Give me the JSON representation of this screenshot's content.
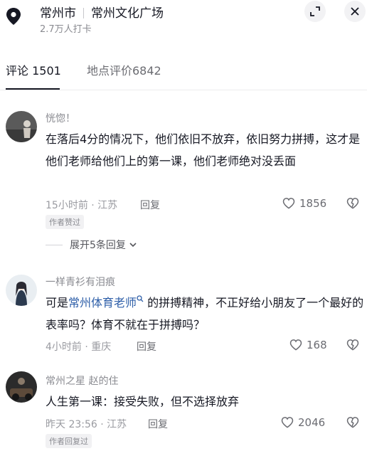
{
  "header": {
    "city": "常州市",
    "place": "常州文化广场",
    "checkins": "2.7万人打卡"
  },
  "tabs": [
    {
      "label": "评论 1501",
      "active": true
    },
    {
      "label": "地点评价6842",
      "active": false
    }
  ],
  "comments": [
    {
      "author": "恍惚！",
      "text": "在落后4分的情况下，他们依旧不放弃，依旧努力拼搏，这才是他们老师给他们上的第一课，他们老师绝对没丢面",
      "time": "15小时前 · 江苏",
      "reply": "回复",
      "likes": "1856",
      "badge": "作者赞过",
      "more": "展开5条回复"
    },
    {
      "author": "一样青衫有泪痕",
      "text_before": "可是",
      "link": "常州体育老师",
      "text_after": " 的拼搏精神，不正好给小朋友了一个最好的表率吗？体育不就在于拼搏吗？",
      "time": "4小时前 · 重庆",
      "reply": "回复",
      "likes": "168"
    },
    {
      "author": "常州之星 赵的住",
      "text": "人生第一课：接受失败，但不选择放弃",
      "time": "昨天 23:56 · 江苏",
      "reply": "回复",
      "likes": "2046",
      "badge": "作者回复过"
    }
  ],
  "colors": {
    "link": "#2d5ea8",
    "text": "#161823",
    "muted": "#8a8b91"
  }
}
